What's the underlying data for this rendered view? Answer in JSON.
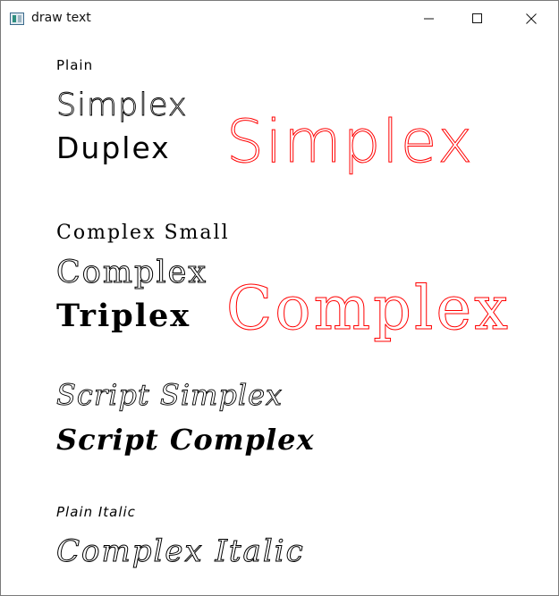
{
  "window": {
    "title": "draw text",
    "icon": "app-window-icon",
    "controls": {
      "minimize_icon": "minimize-icon",
      "maximize_icon": "maximize-icon",
      "close_icon": "close-icon"
    }
  },
  "samples": {
    "plain": "Plain",
    "simplex": "Simplex",
    "duplex": "Duplex",
    "simplex_large": "Simplex",
    "complex_small": "Complex Small",
    "complex": "Complex",
    "triplex": "Triplex",
    "complex_large": "Complex",
    "script_simplex": "Script Simplex",
    "script_complex": "Script Complex",
    "plain_italic": "Plain Italic",
    "complex_italic": "Complex Italic"
  },
  "colors": {
    "text": "#000000",
    "highlight": "#ff0000",
    "title_text": "#111111",
    "border": "#7a7a7a"
  }
}
